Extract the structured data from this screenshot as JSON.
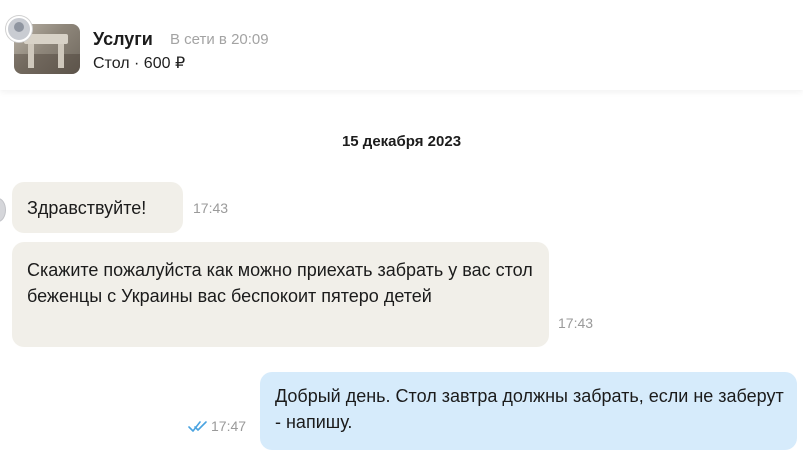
{
  "header": {
    "title": "Услуги",
    "status": "В сети в 20:09",
    "subtitle": "Стол · 600 ₽"
  },
  "chat": {
    "date": "15 декабря 2023",
    "messages": [
      {
        "direction": "incoming",
        "text": "Здравствуйте!",
        "time": "17:43"
      },
      {
        "direction": "incoming",
        "text": "Скажите пожалуйста как можно приехать забрать у вас стол беженцы с Украины вас беспокоит пятеро детей",
        "time": "17:43"
      },
      {
        "direction": "outgoing",
        "text": "Добрый день. Стол завтра должны забрать, если не заберут - напишу.",
        "time": "17:47",
        "read": true
      }
    ]
  },
  "colors": {
    "incoming_bubble": "#f1efe9",
    "outgoing_bubble": "#d6ebfb",
    "read_check": "#4aa3e0"
  }
}
